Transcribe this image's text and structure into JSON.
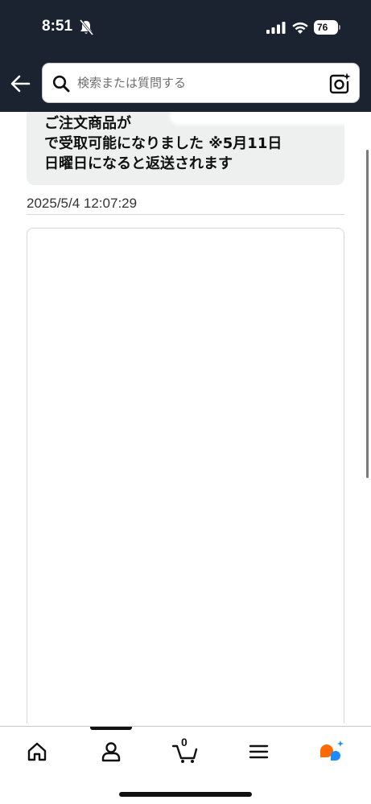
{
  "status_bar": {
    "time": "8:51",
    "battery": "76",
    "icons": [
      "bell-muted-icon",
      "signal-icon",
      "wifi-icon",
      "battery-icon"
    ]
  },
  "header": {
    "search_placeholder": "検索または質問する",
    "icons": [
      "back-arrow-icon",
      "search-icon",
      "camera-icon"
    ]
  },
  "message": {
    "text": "ご注文商品が\nで受取可能になりました ※5月11日\n日曜日になると返送されます",
    "timestamp": "2025/5/4 12:07:29"
  },
  "bottom_nav": {
    "items": [
      "home-icon",
      "account-icon",
      "cart-icon",
      "menu-icon",
      "assistant-icon"
    ],
    "cart_count": "0",
    "active_index": 1
  },
  "colors": {
    "header_bg": "#1b2330",
    "bubble_bg": "#eef0f0",
    "assistant_orange": "#ff6a00",
    "assistant_blue": "#1a8cff"
  }
}
